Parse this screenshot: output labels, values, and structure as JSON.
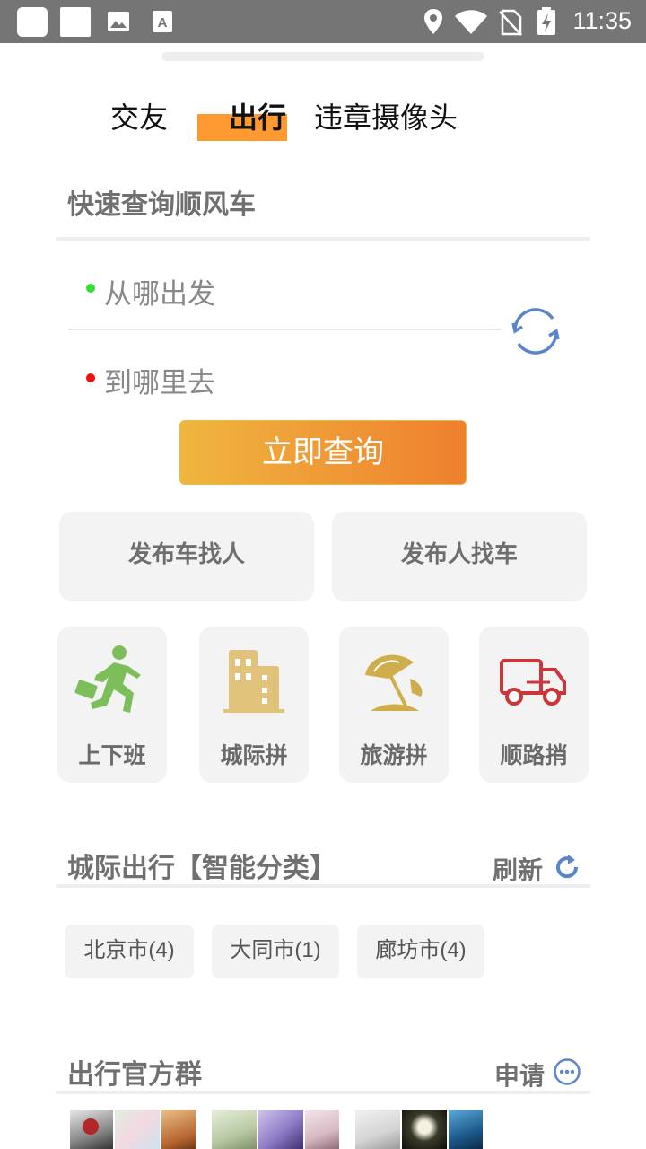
{
  "status_bar": {
    "time": "11:35"
  },
  "tabs": [
    {
      "label": "交友",
      "active": false
    },
    {
      "label": "出行",
      "active": true
    },
    {
      "label": "违章摄像头",
      "active": false
    }
  ],
  "search": {
    "title": "快速查询顺风车",
    "from_placeholder": "从哪出发",
    "to_placeholder": "到哪里去",
    "query_button": "立即查询",
    "from_dot_color": "#33dd33",
    "to_dot_color": "#ee1111"
  },
  "publish": {
    "car_seek_people": "发布车找人",
    "people_seek_car": "发布人找车"
  },
  "categories": [
    {
      "label": "上下班",
      "icon": "commuter-running-icon"
    },
    {
      "label": "城际拼",
      "icon": "buildings-icon"
    },
    {
      "label": "旅游拼",
      "icon": "beach-umbrella-icon"
    },
    {
      "label": "顺路捎",
      "icon": "truck-icon"
    }
  ],
  "intercity": {
    "title": "城际出行【智能分类】",
    "refresh_label": "刷新",
    "cities": [
      "北京市(4)",
      "大同市(1)",
      "廊坊市(4)"
    ]
  },
  "groups": {
    "title": "出行官方群",
    "apply_label": "申请"
  },
  "colors": {
    "accent_orange": "#ff9a33",
    "icon_blue": "#5a86c9"
  }
}
